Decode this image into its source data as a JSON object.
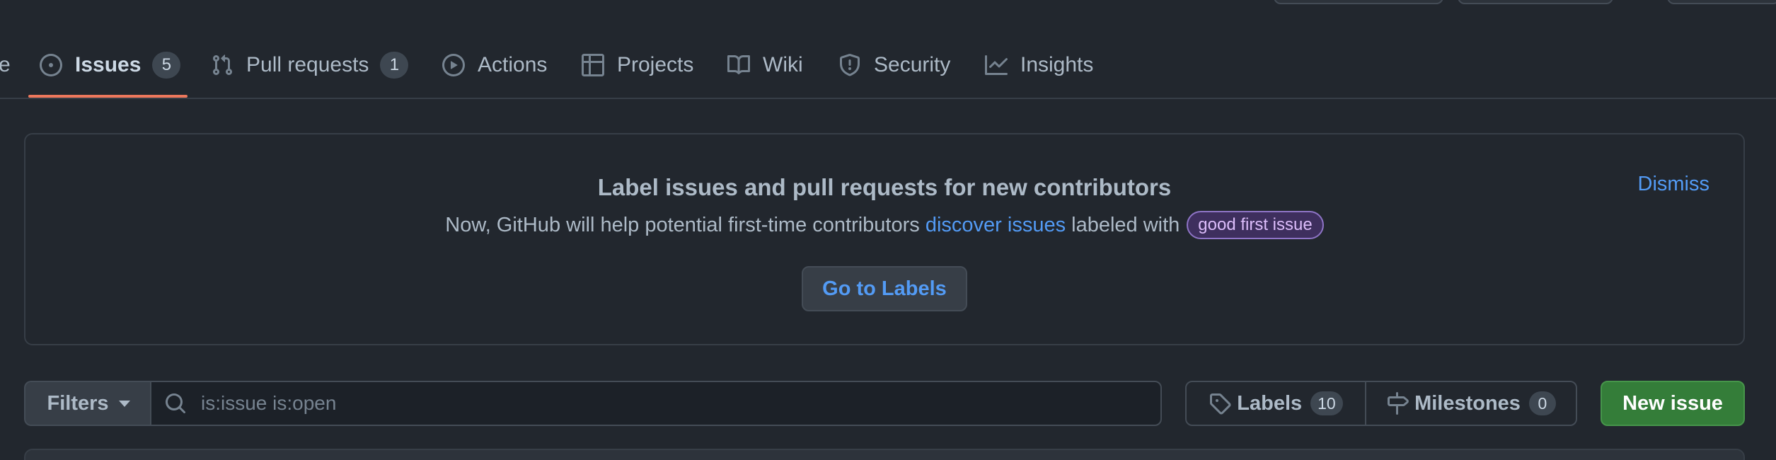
{
  "tabs": [
    {
      "label": "Issues",
      "count": "5",
      "icon": "issue-opened-icon",
      "selected": true
    },
    {
      "label": "Pull requests",
      "count": "1",
      "icon": "git-pull-request-icon"
    },
    {
      "label": "Actions",
      "icon": "play-icon"
    },
    {
      "label": "Projects",
      "icon": "table-icon"
    },
    {
      "label": "Wiki",
      "icon": "book-icon"
    },
    {
      "label": "Security",
      "icon": "shield-icon"
    },
    {
      "label": "Insights",
      "icon": "graph-icon"
    }
  ],
  "partial_tab_text": "e",
  "banner": {
    "title": "Label issues and pull requests for new contributors",
    "text_before": "Now, GitHub will help potential first-time contributors ",
    "link_text": "discover issues",
    "text_after": " labeled with",
    "label": "good first issue",
    "dismiss": "Dismiss",
    "button": "Go to Labels"
  },
  "filters": {
    "button": "Filters",
    "search_placeholder": "is:issue is:open"
  },
  "labels_button": {
    "label": "Labels",
    "count": "10"
  },
  "milestones_button": {
    "label": "Milestones",
    "count": "0"
  },
  "new_issue_button": "New issue",
  "colors": {
    "background": "#22272e",
    "accent": "#ec775c",
    "link": "#539bf5",
    "primary_button": "#347d39"
  }
}
